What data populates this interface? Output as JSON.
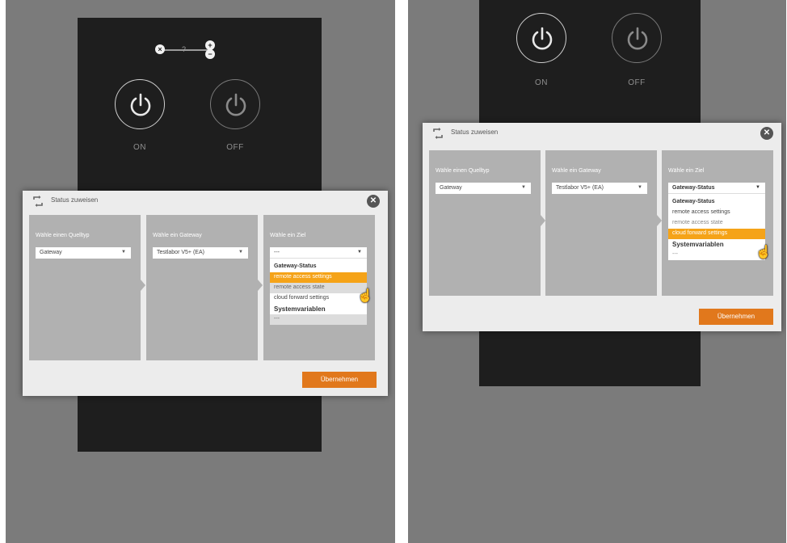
{
  "common": {
    "on_label": "ON",
    "off_label": "OFF",
    "dialog_title": "Status zuweisen",
    "close_glyph": "✕",
    "col1_label": "Wähle einen Quelltyp",
    "col2_label": "Wähle ein Gateway",
    "col3_label": "Wähle ein Ziel",
    "source_type_value": "Gateway",
    "gateway_value": "Testlabor V5+ (EA)",
    "apply_label": "Übernehmen",
    "colors": {
      "accent": "#e1781c",
      "highlight": "#f5a318",
      "device": "#1e1e1e"
    },
    "icons": [
      "power-icon",
      "status-assign-icon",
      "close-icon",
      "chevron-down-icon",
      "hand-pointer-icon"
    ]
  },
  "left_panel": {
    "slider_symbol": "?",
    "target_head": "---",
    "target_options": [
      "Gateway-Status",
      "remote access settings",
      "remote access state",
      "cloud forward settings",
      "Systemvariablen",
      "---"
    ],
    "highlighted": "remote access settings"
  },
  "right_panel": {
    "target_head": "Gateway-Status",
    "target_options": [
      "Gateway-Status",
      "remote access settings",
      "remote access state",
      "cloud forward settings",
      "Systemvariablen",
      "---"
    ],
    "highlighted": "cloud forward settings"
  }
}
